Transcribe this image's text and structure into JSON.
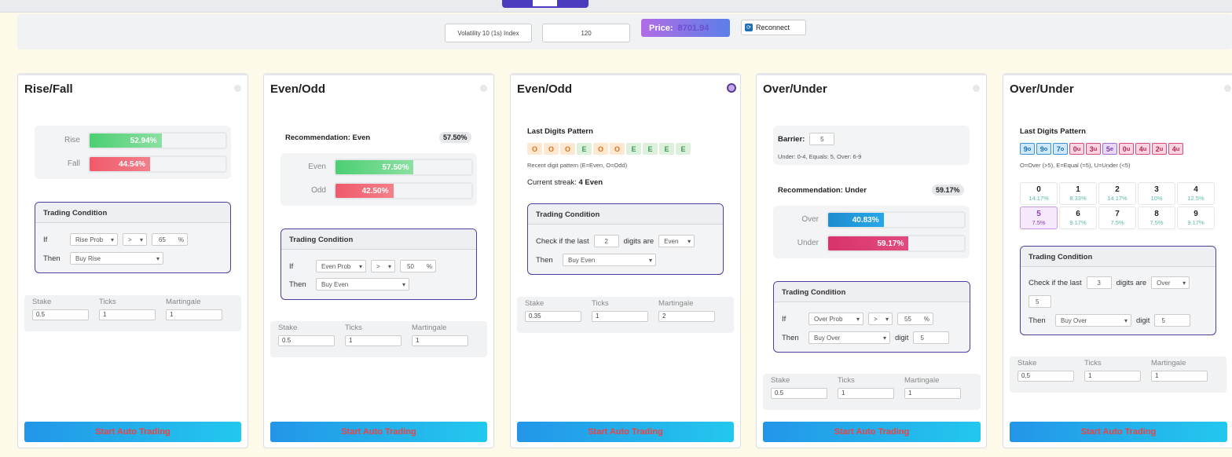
{
  "controls": {
    "symbol": "Volatility 10 (1s) Index",
    "duration": "120",
    "price_label": "Price:",
    "price_value": "8701.94",
    "reconnect_label": "Reconnect"
  },
  "card1": {
    "title": "Rise/Fall",
    "rise_label": "Rise",
    "rise_value": "52.94%",
    "rise_pct": 52.94,
    "fall_label": "Fall",
    "fall_value": "44.54%",
    "fall_pct": 44.54,
    "tc_title": "Trading Condition",
    "if_label": "If",
    "if_select": "Rise Prob",
    "op_select": ">",
    "threshold": "65",
    "pct_sign": "%",
    "then_label": "Then",
    "then_select": "Buy Rise",
    "stake_label": "Stake",
    "stake_value": "0.5",
    "ticks_label": "Ticks",
    "ticks_value": "1",
    "mart_label": "Martingale",
    "mart_value": "1",
    "start_label": "Start Auto Trading"
  },
  "card2": {
    "title": "Even/Odd",
    "recommendation": "Recommendation: Even",
    "rec_pct": "57.50%",
    "even_label": "Even",
    "even_value": "57.50%",
    "even_pct": 57.5,
    "odd_label": "Odd",
    "odd_value": "42.50%",
    "odd_pct": 42.5,
    "tc_title": "Trading Condition",
    "if_label": "If",
    "if_select": "Even Prob",
    "op_select": ">",
    "threshold": "50",
    "pct_sign": "%",
    "then_label": "Then",
    "then_select": "Buy Even",
    "stake_label": "Stake",
    "stake_value": "0.5",
    "ticks_label": "Ticks",
    "ticks_value": "1",
    "mart_label": "Martingale",
    "mart_value": "1",
    "start_label": "Start Auto Trading"
  },
  "card3": {
    "title": "Even/Odd",
    "pattern_title": "Last Digits Pattern",
    "pattern": [
      "O",
      "O",
      "O",
      "E",
      "O",
      "O",
      "E",
      "E",
      "E",
      "E"
    ],
    "pattern_note": "Recent digit pattern (E=Even, O=Odd)",
    "streak_label": "Current streak:",
    "streak_value": "4 Even",
    "tc_title": "Trading Condition",
    "check_label": "Check if the last",
    "check_count": "2",
    "digits_are": "digits are",
    "check_select": "Even",
    "then_label": "Then",
    "then_select": "Buy Even",
    "stake_label": "Stake",
    "stake_value": "0.35",
    "ticks_label": "Ticks",
    "ticks_value": "1",
    "mart_label": "Martingale",
    "mart_value": "2",
    "start_label": "Start Auto Trading"
  },
  "card4": {
    "title": "Over/Under",
    "barrier_label": "Barrier:",
    "barrier_value": "5",
    "barrier_note": "Under: 0-4, Equals: 5, Over: 6-9",
    "recommendation": "Recommendation: Under",
    "rec_pct": "59.17%",
    "over_label": "Over",
    "over_value": "40.83%",
    "over_pct": 40.83,
    "under_label": "Under",
    "under_value": "59.17%",
    "under_pct": 59.17,
    "tc_title": "Trading Condition",
    "if_label": "If",
    "if_select": "Over Prob",
    "op_select": ">",
    "threshold": "55",
    "pct_sign": "%",
    "then_label": "Then",
    "then_select": "Buy Over",
    "digit_label": "digit",
    "digit_value": "5",
    "stake_label": "Stake",
    "stake_value": "0.5",
    "ticks_label": "Ticks",
    "ticks_value": "1",
    "mart_label": "Martingale",
    "mart_value": "1",
    "start_label": "Start Auto Trading"
  },
  "card5": {
    "title": "Over/Under",
    "pattern_title": "Last Digits Pattern",
    "pattern": [
      {
        "d": "9",
        "s": "o"
      },
      {
        "d": "9",
        "s": "o"
      },
      {
        "d": "7",
        "s": "o"
      },
      {
        "d": "0",
        "s": "u"
      },
      {
        "d": "3",
        "s": "u"
      },
      {
        "d": "5",
        "s": "e"
      },
      {
        "d": "0",
        "s": "u"
      },
      {
        "d": "4",
        "s": "u"
      },
      {
        "d": "2",
        "s": "u"
      },
      {
        "d": "4",
        "s": "u"
      }
    ],
    "pattern_note": "O=Over (>5), E=Equal (=5), U=Under (<5)",
    "digits": [
      {
        "d": "0",
        "p": "14.17%"
      },
      {
        "d": "1",
        "p": "8.33%"
      },
      {
        "d": "2",
        "p": "14.17%"
      },
      {
        "d": "3",
        "p": "10%"
      },
      {
        "d": "4",
        "p": "12.5%"
      },
      {
        "d": "5",
        "p": "7.5%"
      },
      {
        "d": "6",
        "p": "9.17%"
      },
      {
        "d": "7",
        "p": "7.5%"
      },
      {
        "d": "8",
        "p": "7.5%"
      },
      {
        "d": "9",
        "p": "9.17%"
      }
    ],
    "tc_title": "Trading Condition",
    "check_label": "Check if the last",
    "check_count": "3",
    "digits_are": "digits are",
    "check_select": "Over",
    "extra_value": "5",
    "then_label": "Then",
    "then_select": "Buy Over",
    "digit_label": "digit",
    "digit_value": "5",
    "stake_label": "Stake",
    "stake_value": "0.5",
    "ticks_label": "Ticks",
    "ticks_value": "1",
    "mart_label": "Martingale",
    "mart_value": "1",
    "start_label": "Start Auto Trading"
  }
}
